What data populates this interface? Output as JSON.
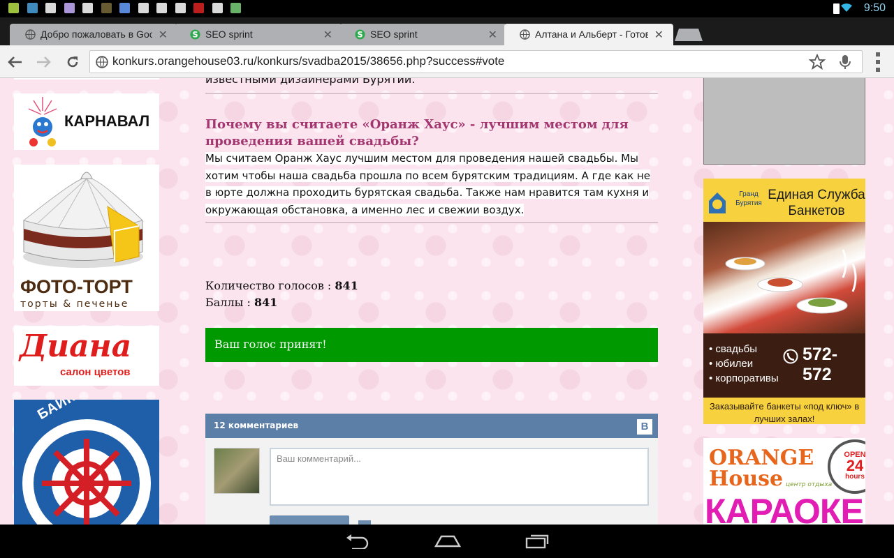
{
  "status_bar": {
    "time": "9:50",
    "notification_icons": [
      "#b8e34a",
      "#4aa3df",
      "#ffffff",
      "#c9b0ff",
      "#ffffff",
      "#7a6a3a",
      "#6aa0ff",
      "#ffffff",
      "#ffffff",
      "#ffffff",
      "#d22",
      "#ffffff",
      "#7bd07b"
    ]
  },
  "tabs": [
    {
      "title": "Добро пожаловать в Goo",
      "favicon": "globe-icon",
      "active": false
    },
    {
      "title": "SEO sprint",
      "favicon": "seo-sprint-icon",
      "active": false
    },
    {
      "title": "SEO sprint",
      "favicon": "seo-sprint-icon",
      "active": false
    },
    {
      "title": "Алтана и Альберт - Готов",
      "favicon": "globe-icon",
      "active": true
    }
  ],
  "toolbar": {
    "url": "konkurs.orangehouse03.ru/konkurs/svadba2015/38656.php?success#vote"
  },
  "ads_left": {
    "karnaval": "КАРНАВАЛ",
    "foto_tort_title": "ФОТО-ТОРТ",
    "foto_tort_sub": "торты & печенье",
    "diana_title": "Диана",
    "diana_sub": "салон цветов",
    "baikal": "БАЙКАЛЬСКИЙ"
  },
  "ads_right": {
    "grand_buryatia": "Гранд Бурятия",
    "service_title": "Единая Служба Банкетов",
    "items": [
      "свадьбы",
      "юбилеи",
      "корпоративы"
    ],
    "phone": "572-572",
    "slogan": "Заказывайте банкеты «под ключ» в лучших залах!",
    "orange_house": "ORANGE House",
    "orange_house_sub": "центр отдыха",
    "open_badge_top": "OPEN",
    "open_badge_num": "24",
    "open_badge_bottom": "hours",
    "karaoke": "КАРАОКЕ"
  },
  "main": {
    "cut_text": "известными дизайнерами Бурятии.",
    "question": "Почему вы считаете «Оранж Хаус» - лучшим местом для проведения вашей свадьбы?",
    "answer": "Мы считаем Оранж Хаус лучшим местом для проведения нашей свадьбы. Мы хотим чтобы наша свадьба прошла по всем бурятским традициям. А где как не в юрте должна проходить бурятская свадьба. Также нам нравится там кухня и окружающая обстановка, а именно лес и свежии воздух.",
    "votes_label": "Количество голосов :",
    "votes_value": "841",
    "points_label": "Баллы :",
    "points_value": "841",
    "vote_accepted": "Ваш голос принят!"
  },
  "comments": {
    "header": "12 комментариев",
    "vk_logo": "В",
    "placeholder": "Ваш комментарий..."
  },
  "colors": {
    "accent_question": "#a3366f",
    "vote_ok": "#009a00",
    "vk_blue": "#5b7fa6"
  }
}
